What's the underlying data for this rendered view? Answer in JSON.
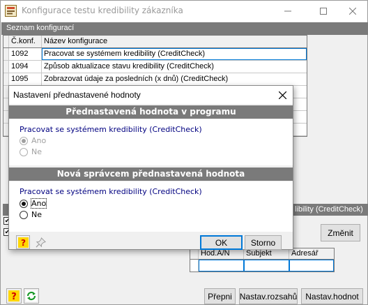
{
  "window": {
    "title": "Konfigurace testu kredibility zákazníka"
  },
  "list_section": {
    "label": "Seznam konfigurací"
  },
  "grid": {
    "columns": [
      "Č.konf.",
      "Název konfigurace"
    ],
    "rows": [
      {
        "id": "1092",
        "name": "Pracovat se systémem kredibility (CreditCheck)"
      },
      {
        "id": "1094",
        "name": "Způsob aktualizace stavu kredibility (CreditCheck)"
      },
      {
        "id": "1095",
        "name": "Zobrazovat údaje za posledních (x dnů) (CreditCheck)"
      }
    ]
  },
  "background": {
    "panel_head": "libility (CreditCheck)",
    "change_button": "Změnit",
    "sub_columns": [
      "Hod.A/N",
      "Subjekt",
      "Adresář"
    ]
  },
  "bottom_buttons": {
    "prepni": "Přepni",
    "nastav_rozsahu": "Nastav.rozsahů",
    "nastav_hodnot": "Nastav.hodnot"
  },
  "dialog": {
    "title": "Nastavení přednastavené hodnoty",
    "program_section": "Přednastavená hodnota v programu",
    "program_label": "Pracovat se systémem kredibility (CreditCheck)",
    "program_options": [
      "Ano",
      "Ne"
    ],
    "program_selected": "Ano",
    "admin_section": "Nová správcem přednastavená hodnota",
    "admin_label": "Pracovat se systémem kredibility (CreditCheck)",
    "admin_options": [
      "Ano",
      "Ne"
    ],
    "admin_selected": "Ano",
    "ok": "OK",
    "cancel": "Storno"
  },
  "colors": {
    "section_bar": "#7a7a7a",
    "selection": "#0078d7",
    "label_blue": "#000080"
  },
  "icons": [
    "app-icon",
    "minimize-icon",
    "maximize-icon",
    "close-icon",
    "help-icon",
    "pin-icon",
    "refresh-icon"
  ]
}
